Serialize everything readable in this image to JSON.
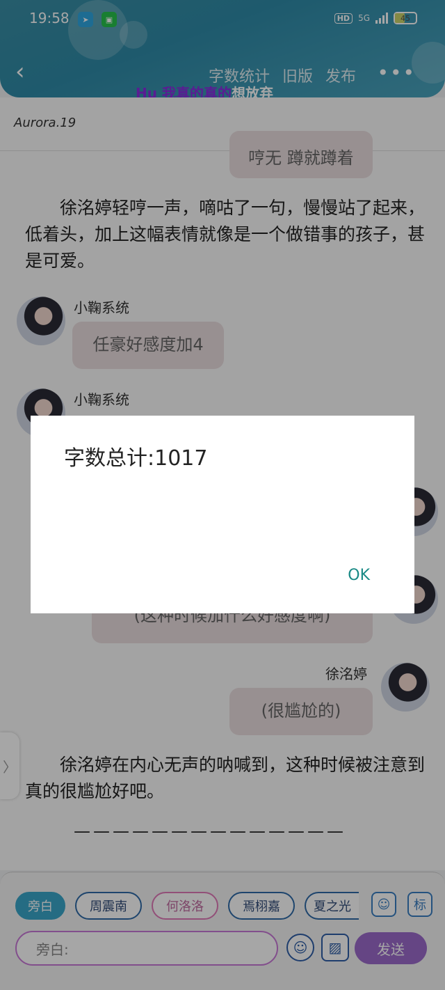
{
  "status": {
    "time": "19:58",
    "network": "5G",
    "battery": "45",
    "hd": "HD"
  },
  "header": {
    "actions": [
      "字数统计",
      "旧版",
      "发布"
    ],
    "scrolling_title_part1": "Hu 我真的真的",
    "scrolling_title_part2": "想放弃"
  },
  "content": {
    "author": "Aurora.19",
    "top_bubble": "哼无 蹲就蹲着",
    "para1": "徐洺婷轻哼一声，嘀咕了一句，慢慢站了起来，低着头，加上这幅表情就像是一个做错事的孩子，甚是可爱。",
    "system_name_1": "小鞠系统",
    "system_msg_1": "任豪好感度加4",
    "system_name_2": "小鞠系统",
    "hidden_bubble": "(这种时候加什么好感度啊)",
    "char_name": "徐洺婷",
    "char_msg": "(很尴尬的)",
    "para2": "徐洺婷在内心无声的呐喊到，这种时候被注意到真的很尴尬好吧。",
    "separator": "——————————————"
  },
  "dialog": {
    "text": "字数总计:1017",
    "ok_label": "OK"
  },
  "bottom": {
    "roles": [
      "旁白",
      "周震南",
      "何洛洛",
      "焉栩嘉",
      "夏之光"
    ],
    "input_placeholder": "旁白:",
    "send_label": "发送",
    "side_icons": [
      "user-icon",
      "tag-icon"
    ],
    "tag_label": "标"
  }
}
